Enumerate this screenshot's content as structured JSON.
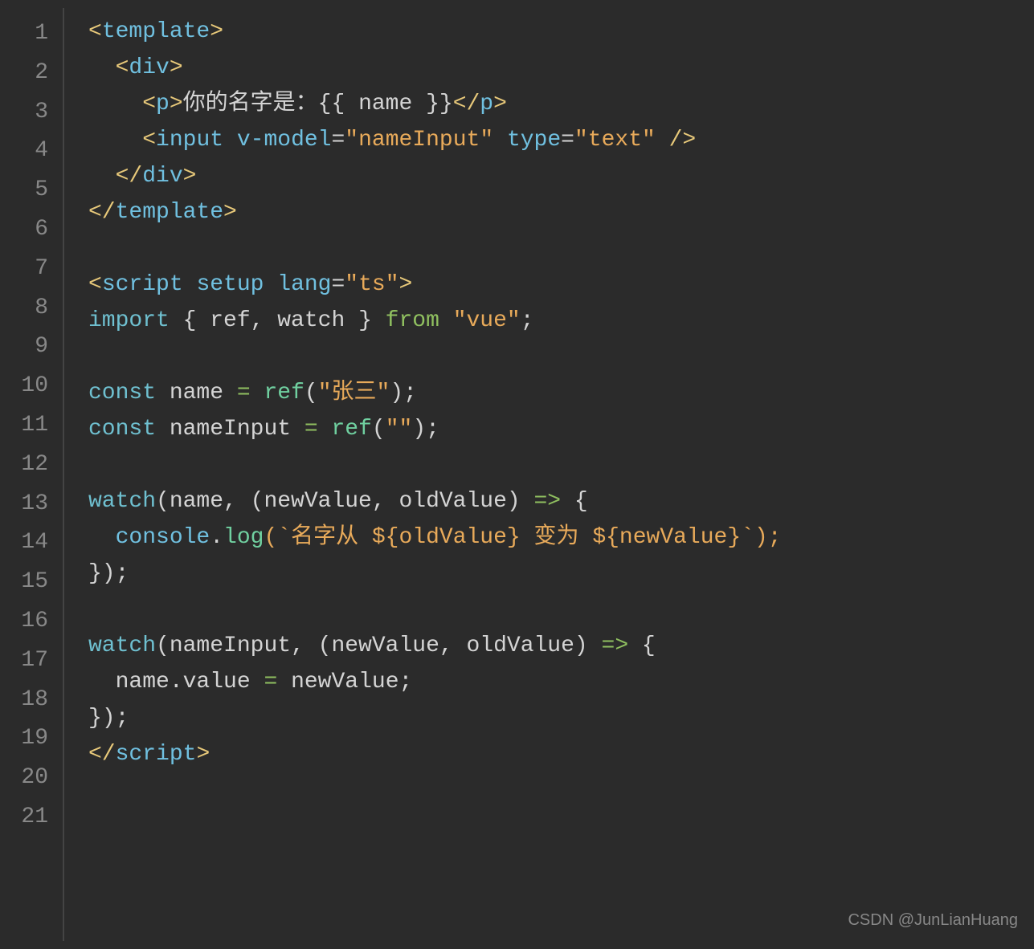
{
  "editor": {
    "background": "#2b2b2b",
    "lines": [
      {
        "num": 1,
        "tokens": [
          {
            "t": "<",
            "c": "c-tag"
          },
          {
            "t": "template",
            "c": "c-tagname"
          },
          {
            "t": ">",
            "c": "c-tag"
          }
        ]
      },
      {
        "num": 2,
        "tokens": [
          {
            "t": "  <",
            "c": "c-tag"
          },
          {
            "t": "div",
            "c": "c-tagname"
          },
          {
            "t": ">",
            "c": "c-tag"
          }
        ]
      },
      {
        "num": 3,
        "tokens": [
          {
            "t": "    <",
            "c": "c-tag"
          },
          {
            "t": "p",
            "c": "c-tagname"
          },
          {
            "t": ">",
            "c": "c-tag"
          },
          {
            "t": "你的名字是：{{ name }}</",
            "c": "c-text"
          },
          {
            "t": "p",
            "c": "c-tagname"
          },
          {
            "t": ">",
            "c": "c-tag"
          }
        ]
      },
      {
        "num": 4,
        "tokens": [
          {
            "t": "    <",
            "c": "c-tag"
          },
          {
            "t": "input ",
            "c": "c-tagname"
          },
          {
            "t": "v-model",
            "c": "c-attr-name"
          },
          {
            "t": "=",
            "c": "c-text"
          },
          {
            "t": "\"nameInput\"",
            "c": "c-attr-value"
          },
          {
            "t": " ",
            "c": "c-text"
          },
          {
            "t": "type",
            "c": "c-attr-name"
          },
          {
            "t": "=",
            "c": "c-text"
          },
          {
            "t": "\"text\"",
            "c": "c-attr-value"
          },
          {
            "t": " />",
            "c": "c-tag"
          }
        ]
      },
      {
        "num": 5,
        "tokens": [
          {
            "t": "  </",
            "c": "c-tag"
          },
          {
            "t": "div",
            "c": "c-tagname"
          },
          {
            "t": ">",
            "c": "c-tag"
          }
        ]
      },
      {
        "num": 6,
        "tokens": [
          {
            "t": "</",
            "c": "c-tag"
          },
          {
            "t": "template",
            "c": "c-tagname"
          },
          {
            "t": ">",
            "c": "c-tag"
          }
        ]
      },
      {
        "num": 7,
        "tokens": []
      },
      {
        "num": 8,
        "tokens": [
          {
            "t": "<",
            "c": "c-tag"
          },
          {
            "t": "script ",
            "c": "c-tagname"
          },
          {
            "t": "setup ",
            "c": "c-attr-name"
          },
          {
            "t": "lang",
            "c": "c-attr-name"
          },
          {
            "t": "=",
            "c": "c-text"
          },
          {
            "t": "\"ts\"",
            "c": "c-attr-value"
          },
          {
            "t": ">",
            "c": "c-tag"
          }
        ]
      },
      {
        "num": 9,
        "tokens": [
          {
            "t": "import",
            "c": "c-keyword"
          },
          {
            "t": " { ref, watch } ",
            "c": "c-text"
          },
          {
            "t": "from",
            "c": "c-from"
          },
          {
            "t": " ",
            "c": "c-text"
          },
          {
            "t": "\"vue\"",
            "c": "c-string"
          },
          {
            "t": ";",
            "c": "c-text"
          }
        ]
      },
      {
        "num": 10,
        "tokens": []
      },
      {
        "num": 11,
        "tokens": [
          {
            "t": "const",
            "c": "c-keyword"
          },
          {
            "t": " name ",
            "c": "c-text"
          },
          {
            "t": "=",
            "c": "c-green"
          },
          {
            "t": " ",
            "c": "c-text"
          },
          {
            "t": "ref",
            "c": "c-ref"
          },
          {
            "t": "(",
            "c": "c-text"
          },
          {
            "t": "\"张三\"",
            "c": "c-string"
          },
          {
            "t": ");",
            "c": "c-text"
          }
        ]
      },
      {
        "num": 12,
        "tokens": [
          {
            "t": "const",
            "c": "c-keyword"
          },
          {
            "t": " nameInput ",
            "c": "c-text"
          },
          {
            "t": "=",
            "c": "c-green"
          },
          {
            "t": " ",
            "c": "c-text"
          },
          {
            "t": "ref",
            "c": "c-ref"
          },
          {
            "t": "(",
            "c": "c-text"
          },
          {
            "t": "\"\"",
            "c": "c-string"
          },
          {
            "t": ");",
            "c": "c-text"
          }
        ]
      },
      {
        "num": 13,
        "tokens": []
      },
      {
        "num": 14,
        "tokens": [
          {
            "t": "watch",
            "c": "c-keyword"
          },
          {
            "t": "(name, (newValue, oldValue) ",
            "c": "c-text"
          },
          {
            "t": "=>",
            "c": "c-green"
          },
          {
            "t": " {",
            "c": "c-text"
          }
        ]
      },
      {
        "num": 15,
        "tokens": [
          {
            "t": "  ",
            "c": "c-text"
          },
          {
            "t": "console",
            "c": "c-console"
          },
          {
            "t": ".",
            "c": "c-text"
          },
          {
            "t": "log",
            "c": "c-ref"
          },
          {
            "t": "(`名字从 ${oldValue} 变为 ${newValue}`);",
            "c": "c-string"
          }
        ]
      },
      {
        "num": 16,
        "tokens": [
          {
            "t": "});",
            "c": "c-text"
          }
        ]
      },
      {
        "num": 17,
        "tokens": []
      },
      {
        "num": 18,
        "tokens": [
          {
            "t": "watch",
            "c": "c-keyword"
          },
          {
            "t": "(nameInput, (newValue, oldValue) ",
            "c": "c-text"
          },
          {
            "t": "=>",
            "c": "c-green"
          },
          {
            "t": " {",
            "c": "c-text"
          }
        ]
      },
      {
        "num": 19,
        "tokens": [
          {
            "t": "  name.value ",
            "c": "c-text"
          },
          {
            "t": "=",
            "c": "c-green"
          },
          {
            "t": " newValue;",
            "c": "c-text"
          }
        ]
      },
      {
        "num": 20,
        "tokens": [
          {
            "t": "});",
            "c": "c-text"
          }
        ]
      },
      {
        "num": 21,
        "tokens": [
          {
            "t": "</",
            "c": "c-tag"
          },
          {
            "t": "script",
            "c": "c-tagname"
          },
          {
            "t": ">",
            "c": "c-tag"
          }
        ]
      }
    ],
    "watermark": "CSDN @JunLianHuang"
  }
}
